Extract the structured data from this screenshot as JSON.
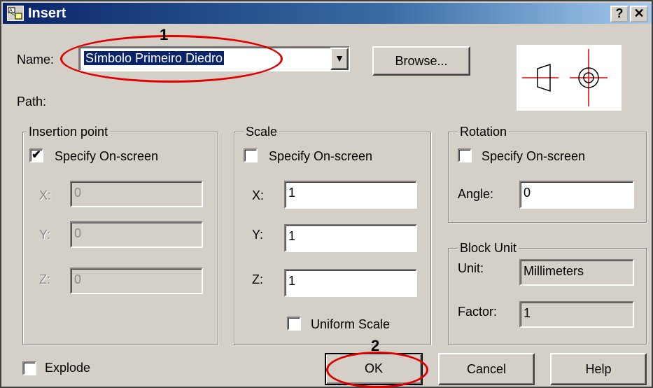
{
  "window": {
    "title": "Insert",
    "help_glyph": "?",
    "close_glyph": "✕"
  },
  "name_row": {
    "label": "Name:",
    "value": "Símbolo Primeiro Diedro",
    "dropdown_glyph": "▼",
    "browse_label": "Browse..."
  },
  "path": {
    "label": "Path:"
  },
  "insertion_point": {
    "legend": "Insertion point",
    "specify_label": "Specify On-screen",
    "specify_checked": true,
    "x_label": "X:",
    "x_value": "0",
    "y_label": "Y:",
    "y_value": "0",
    "z_label": "Z:",
    "z_value": "0"
  },
  "scale": {
    "legend": "Scale",
    "specify_label": "Specify On-screen",
    "specify_checked": false,
    "x_label": "X:",
    "x_value": "1",
    "y_label": "Y:",
    "y_value": "1",
    "z_label": "Z:",
    "z_value": "1",
    "uniform_label": "Uniform Scale",
    "uniform_checked": false
  },
  "rotation": {
    "legend": "Rotation",
    "specify_label": "Specify On-screen",
    "specify_checked": false,
    "angle_label": "Angle:",
    "angle_value": "0"
  },
  "block_unit": {
    "legend": "Block Unit",
    "unit_label": "Unit:",
    "unit_value": "Millimeters",
    "factor_label": "Factor:",
    "factor_value": "1"
  },
  "explode": {
    "label": "Explode",
    "checked": false
  },
  "buttons": {
    "ok": "OK",
    "cancel": "Cancel",
    "help": "Help"
  },
  "annotations": {
    "marker_1": "1",
    "marker_2": "2",
    "ring_color": "#e00000"
  },
  "colors": {
    "title_bar": "#0a246a",
    "dialog_face": "#d4d0c8",
    "selection": "#0a246a"
  }
}
